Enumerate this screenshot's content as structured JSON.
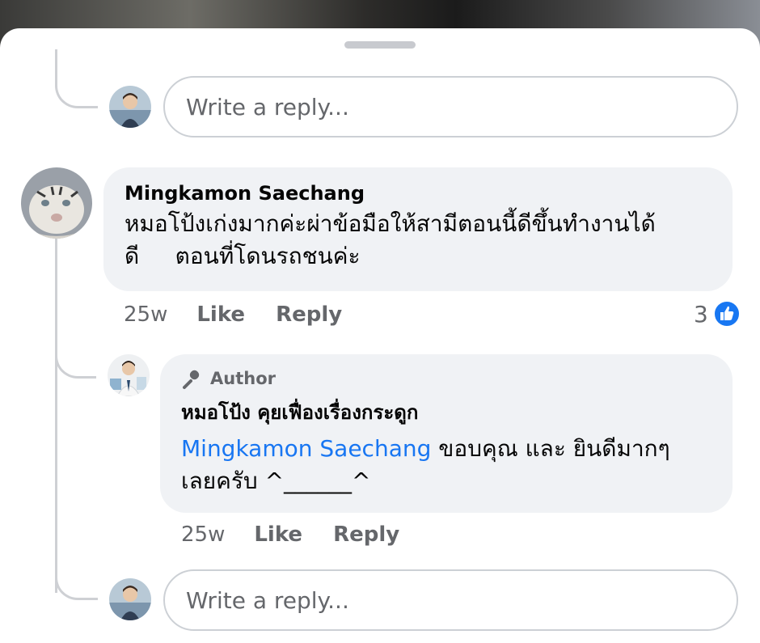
{
  "reply_placeholder": "Write a reply...",
  "comment": {
    "author": "Mingkamon Saechang",
    "text_line1": "หมอโป้งเก่งมากค่ะผ่าข้อมือให้สามีตอนนี้ดีขึ้นทำงานได้",
    "text_line2": "ดี     ตอนที่โดนรถชนค่ะ",
    "time": "25w",
    "like_label": "Like",
    "reply_label": "Reply",
    "reaction_count": "3"
  },
  "reply": {
    "badge": "Author",
    "author": "หมอโป้ง คุยเฟื่องเรื่องกระดูก",
    "mention": "Mingkamon Saechang",
    "text_after_mention": " ขอบคุณ และ ยินดีมากๆ",
    "text_line2": "เลยครับ ^______^",
    "time": "25w",
    "like_label": "Like",
    "reply_label": "Reply"
  },
  "colors": {
    "link": "#1876f2",
    "like_badge": "#1877f2",
    "bubble": "#f0f2f5"
  }
}
